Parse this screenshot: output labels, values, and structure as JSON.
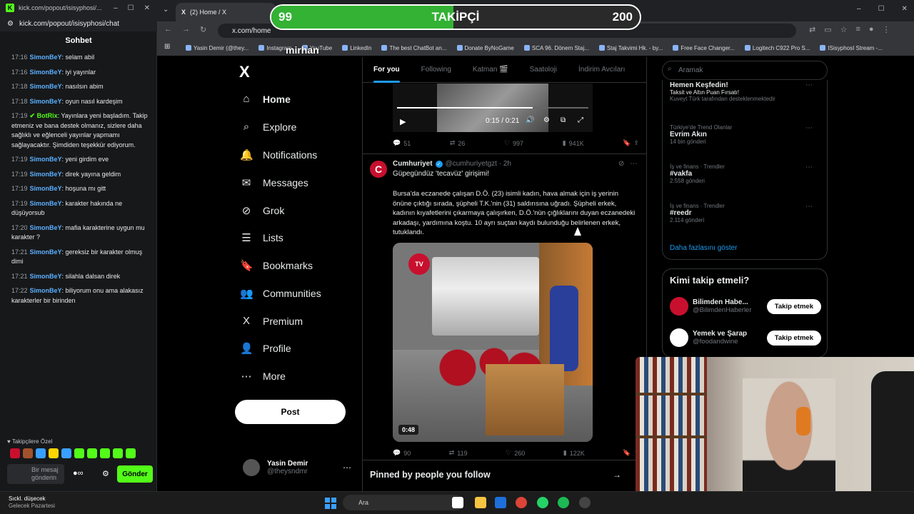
{
  "chat": {
    "titlebar_url": "kick.com/popout/isisyphosi/...",
    "url": "kick.com/popout/isisyphosi/chat",
    "header": "Sohbet",
    "messages": [
      {
        "time": "17:16",
        "user": "SimonBeY",
        "text": ": selam abil"
      },
      {
        "time": "17:16",
        "user": "SimonBeY",
        "text": ": iyi yayınlar"
      },
      {
        "time": "17:18",
        "user": "SimonBeY",
        "text": ": nasılsın abim"
      },
      {
        "time": "17:18",
        "user": "SimonBeY",
        "text": ": oyun nasıl kardeşim"
      },
      {
        "time": "17:19",
        "user": "BotRix",
        "text": ": Yayınlara yeni başladım. Takip etmeniz ve bana destek olmanız, sizlere daha sağlıklı ve eğlenceli yayınlar yapmamı sağlayacaktır. Şimdiden teşekkür ediyorum."
      },
      {
        "time": "17:19",
        "user": "SimonBeY",
        "text": ": yeni girdim eve"
      },
      {
        "time": "17:19",
        "user": "SimonBeY",
        "text": ": direk yayına geldim"
      },
      {
        "time": "17:19",
        "user": "SimonBeY",
        "text": ": hoşuna mı gitt"
      },
      {
        "time": "17:19",
        "user": "SimonBeY",
        "text": ": karakter hakında ne düşüyorsub"
      },
      {
        "time": "17:20",
        "user": "SimonBeY",
        "text": ": mafia karakterine uygun mu karakter ?"
      },
      {
        "time": "17:21",
        "user": "SimonBeY",
        "text": ": gereksiz bir karakter olmuş dimi"
      },
      {
        "time": "17:21",
        "user": "SimonBeY",
        "text": ": silahla dalsan direk"
      },
      {
        "time": "17:22",
        "user": "SimonBeY",
        "text": ": biliyorum onu ama alakasız karakterler bir birinden"
      }
    ],
    "followers_only": "♥ Takipçilere Özel",
    "input_placeholder": "Bir mesaj gönderin",
    "send_label": "Gönder"
  },
  "browser": {
    "tab_title": "(2) Home / X",
    "url": "x.com/home",
    "bookmarks": [
      "Yasin Demir (@they...",
      "Instagram",
      "YouTube",
      "LinkedIn",
      "The best ChatBot an...",
      "Donate ByNoGame",
      "SCA 96. Dönem Staj...",
      "Staj Takvimi Hk. - by...",
      "Free Face Changer...",
      "Logitech C922 Pro S...",
      "ISisyphosI Stream -..."
    ]
  },
  "overlay": {
    "current": "99",
    "label": "TAKİPÇİ",
    "goal": "200",
    "progress": 0.495,
    "watermark": "mirhan"
  },
  "x_nav": {
    "logo": "X",
    "items": [
      {
        "icon": "⌂",
        "label": "Home"
      },
      {
        "icon": "⌕",
        "label": "Explore"
      },
      {
        "icon": "🔔",
        "label": "Notifications"
      },
      {
        "icon": "✉",
        "label": "Messages"
      },
      {
        "icon": "⊘",
        "label": "Grok"
      },
      {
        "icon": "☰",
        "label": "Lists"
      },
      {
        "icon": "🔖",
        "label": "Bookmarks"
      },
      {
        "icon": "👥",
        "label": "Communities"
      },
      {
        "icon": "X",
        "label": "Premium"
      },
      {
        "icon": "👤",
        "label": "Profile"
      },
      {
        "icon": "⋯",
        "label": "More"
      }
    ],
    "post_label": "Post",
    "profile_name": "Yasin Demir",
    "profile_handle": "@theysndmr"
  },
  "timeline": {
    "tabs": [
      "For you",
      "Following",
      "Katman 🎬",
      "Saatoloji",
      "İndirim Avcıları"
    ],
    "video1": {
      "time": "0:15 / 0:21",
      "progress": 0.71,
      "replies": "51",
      "reposts": "26",
      "likes": "997",
      "views": "941K"
    },
    "tweet2": {
      "author": "Cumhuriyet",
      "handle": "@cumhuriyetgzt · 2h",
      "headline": "Güpegündüz 'tecavüz' girişimi!",
      "body": "Bursa'da eczanede çalışan D.Ö. (23) isimli kadın, hava almak için iş yerinin önüne çıktığı sırada, şüpheli T.K.'nin (31) saldırısına uğradı. Şüpheli erkek, kadının kıyafetlerini çıkarmaya çalışırken, D.Ö.'nün çığlıklarını duyan eczanedeki arkadaşı, yardımına koştu. 10 ayrı suçtan kaydı bulunduğu belirlenen erkek, tutuklandı.",
      "video_time": "0:48",
      "replies": "90",
      "reposts": "119",
      "likes": "260",
      "views": "122K"
    },
    "pinned_title": "Pinned by people you follow"
  },
  "right": {
    "search_placeholder": "Aramak",
    "trends": [
      {
        "category": "",
        "title": "Hemen Keşfedin!",
        "sub": "Taksit ve Altın Puan Fırsatı!",
        "posts": "Kuveyt Türk tarafından desteklenmektedir"
      },
      {
        "category": "Türkiye'de Trend Olanlar",
        "title": "Evrim Akın",
        "posts": "14 bin gönderi"
      },
      {
        "category": "İş ve finans · Trendler",
        "title": "#vakfa",
        "posts": "2.558 gönderi"
      },
      {
        "category": "İş ve finans · Trendler",
        "title": "#reedr",
        "posts": "2.114 gönderi"
      }
    ],
    "show_more": "Daha fazlasını göster",
    "who_to_follow": "Kimi takip etmeli?",
    "follow": [
      {
        "name": "Bilimden Habe...",
        "handle": "@BilimdenHaberler",
        "btn": "Takip etmek"
      },
      {
        "name": "Yemek ve Şarap",
        "handle": "@foodandwine",
        "btn": "Takip etmek"
      }
    ]
  },
  "taskbar": {
    "weather_title": "Sıckl. düşecek",
    "weather_sub": "Gelecek Pazartesi",
    "search": "Ara"
  },
  "colors": {
    "kick_green": "#53fc18",
    "x_blue": "#1d9bf0",
    "overlay_green": "#33b234"
  }
}
